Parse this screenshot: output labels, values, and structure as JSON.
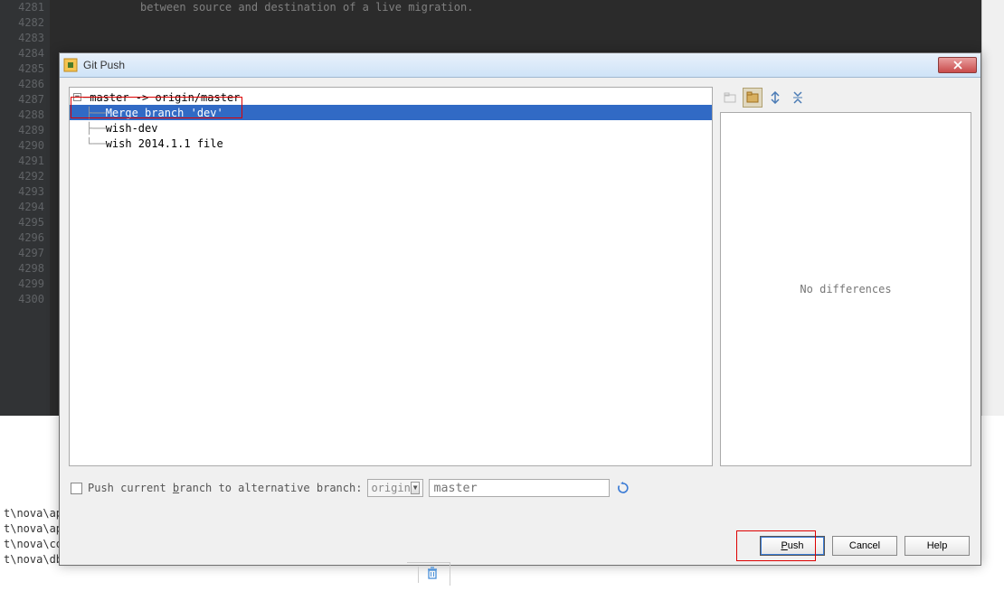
{
  "editor": {
    "line_start": 4281,
    "line_end": 4300,
    "visible_comment": "between source and destination of a live migration."
  },
  "dialog": {
    "title": "Git Push",
    "tree": {
      "root": "master -> origin/master",
      "commits": [
        "Merge branch 'dev'",
        "wish-dev",
        "wish 2014.1.1 file"
      ],
      "selected_index": 0
    },
    "diff": {
      "empty_text": "No differences"
    },
    "alt_branch": {
      "label_prefix": "Push current ",
      "label_underlined": "b",
      "label_suffix": "ranch to alternative branch:",
      "remote": "origin",
      "branch_placeholder": "master"
    },
    "buttons": {
      "push": "Push",
      "cancel": "Cancel",
      "help": "Help"
    }
  },
  "file_tabs": [
    "t\\nova\\ap",
    "t\\nova\\ap",
    "t\\nova\\co",
    "t\\nova\\db\\api.py"
  ]
}
